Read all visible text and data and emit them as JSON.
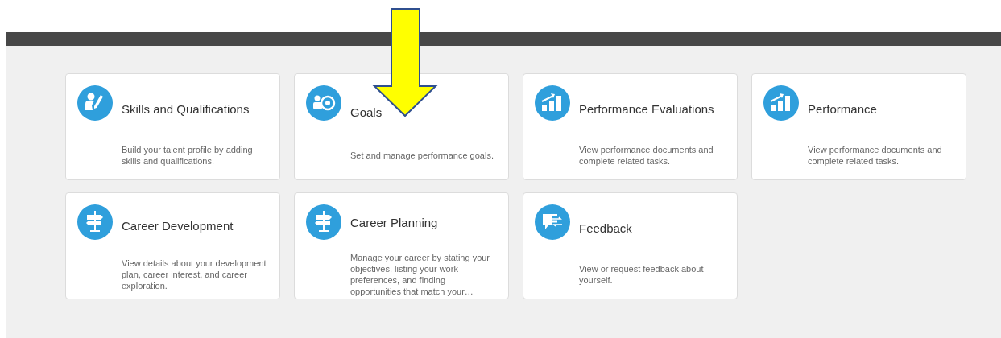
{
  "cards": [
    {
      "kind": "skills",
      "title": "Skills and Qualifications",
      "description": "Build your talent profile by adding skills and qualifications."
    },
    {
      "kind": "goals",
      "title": "Goals",
      "description": "Set and manage performance goals."
    },
    {
      "kind": "chart",
      "title": "Performance Evaluations",
      "description": "View performance documents and complete related tasks."
    },
    {
      "kind": "chart",
      "title": "Performance",
      "description": "View performance documents and complete related tasks."
    },
    {
      "kind": "signpost",
      "title": "Career Development",
      "description": "View details about your development plan, career interest, and career exploration."
    },
    {
      "kind": "signpost",
      "title": "Career Planning",
      "description": "Manage your career by stating your objectives, listing your work preferences, and finding opportunities that match your…"
    },
    {
      "kind": "feedback",
      "title": "Feedback",
      "description": "View or request feedback about yourself."
    }
  ]
}
